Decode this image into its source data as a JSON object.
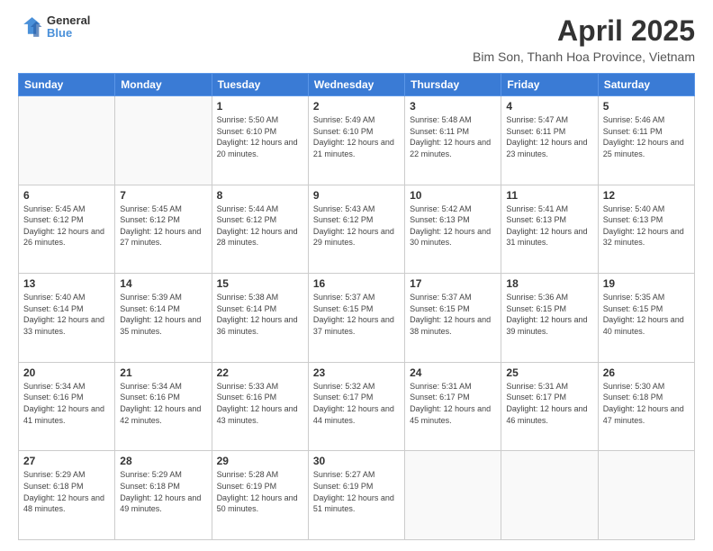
{
  "header": {
    "logo_line1": "General",
    "logo_line2": "Blue",
    "title": "April 2025",
    "location": "Bim Son, Thanh Hoa Province, Vietnam"
  },
  "calendar": {
    "days_of_week": [
      "Sunday",
      "Monday",
      "Tuesday",
      "Wednesday",
      "Thursday",
      "Friday",
      "Saturday"
    ],
    "weeks": [
      [
        {
          "day": "",
          "info": ""
        },
        {
          "day": "",
          "info": ""
        },
        {
          "day": "1",
          "info": "Sunrise: 5:50 AM\nSunset: 6:10 PM\nDaylight: 12 hours and 20 minutes."
        },
        {
          "day": "2",
          "info": "Sunrise: 5:49 AM\nSunset: 6:10 PM\nDaylight: 12 hours and 21 minutes."
        },
        {
          "day": "3",
          "info": "Sunrise: 5:48 AM\nSunset: 6:11 PM\nDaylight: 12 hours and 22 minutes."
        },
        {
          "day": "4",
          "info": "Sunrise: 5:47 AM\nSunset: 6:11 PM\nDaylight: 12 hours and 23 minutes."
        },
        {
          "day": "5",
          "info": "Sunrise: 5:46 AM\nSunset: 6:11 PM\nDaylight: 12 hours and 25 minutes."
        }
      ],
      [
        {
          "day": "6",
          "info": "Sunrise: 5:45 AM\nSunset: 6:12 PM\nDaylight: 12 hours and 26 minutes."
        },
        {
          "day": "7",
          "info": "Sunrise: 5:45 AM\nSunset: 6:12 PM\nDaylight: 12 hours and 27 minutes."
        },
        {
          "day": "8",
          "info": "Sunrise: 5:44 AM\nSunset: 6:12 PM\nDaylight: 12 hours and 28 minutes."
        },
        {
          "day": "9",
          "info": "Sunrise: 5:43 AM\nSunset: 6:12 PM\nDaylight: 12 hours and 29 minutes."
        },
        {
          "day": "10",
          "info": "Sunrise: 5:42 AM\nSunset: 6:13 PM\nDaylight: 12 hours and 30 minutes."
        },
        {
          "day": "11",
          "info": "Sunrise: 5:41 AM\nSunset: 6:13 PM\nDaylight: 12 hours and 31 minutes."
        },
        {
          "day": "12",
          "info": "Sunrise: 5:40 AM\nSunset: 6:13 PM\nDaylight: 12 hours and 32 minutes."
        }
      ],
      [
        {
          "day": "13",
          "info": "Sunrise: 5:40 AM\nSunset: 6:14 PM\nDaylight: 12 hours and 33 minutes."
        },
        {
          "day": "14",
          "info": "Sunrise: 5:39 AM\nSunset: 6:14 PM\nDaylight: 12 hours and 35 minutes."
        },
        {
          "day": "15",
          "info": "Sunrise: 5:38 AM\nSunset: 6:14 PM\nDaylight: 12 hours and 36 minutes."
        },
        {
          "day": "16",
          "info": "Sunrise: 5:37 AM\nSunset: 6:15 PM\nDaylight: 12 hours and 37 minutes."
        },
        {
          "day": "17",
          "info": "Sunrise: 5:37 AM\nSunset: 6:15 PM\nDaylight: 12 hours and 38 minutes."
        },
        {
          "day": "18",
          "info": "Sunrise: 5:36 AM\nSunset: 6:15 PM\nDaylight: 12 hours and 39 minutes."
        },
        {
          "day": "19",
          "info": "Sunrise: 5:35 AM\nSunset: 6:15 PM\nDaylight: 12 hours and 40 minutes."
        }
      ],
      [
        {
          "day": "20",
          "info": "Sunrise: 5:34 AM\nSunset: 6:16 PM\nDaylight: 12 hours and 41 minutes."
        },
        {
          "day": "21",
          "info": "Sunrise: 5:34 AM\nSunset: 6:16 PM\nDaylight: 12 hours and 42 minutes."
        },
        {
          "day": "22",
          "info": "Sunrise: 5:33 AM\nSunset: 6:16 PM\nDaylight: 12 hours and 43 minutes."
        },
        {
          "day": "23",
          "info": "Sunrise: 5:32 AM\nSunset: 6:17 PM\nDaylight: 12 hours and 44 minutes."
        },
        {
          "day": "24",
          "info": "Sunrise: 5:31 AM\nSunset: 6:17 PM\nDaylight: 12 hours and 45 minutes."
        },
        {
          "day": "25",
          "info": "Sunrise: 5:31 AM\nSunset: 6:17 PM\nDaylight: 12 hours and 46 minutes."
        },
        {
          "day": "26",
          "info": "Sunrise: 5:30 AM\nSunset: 6:18 PM\nDaylight: 12 hours and 47 minutes."
        }
      ],
      [
        {
          "day": "27",
          "info": "Sunrise: 5:29 AM\nSunset: 6:18 PM\nDaylight: 12 hours and 48 minutes."
        },
        {
          "day": "28",
          "info": "Sunrise: 5:29 AM\nSunset: 6:18 PM\nDaylight: 12 hours and 49 minutes."
        },
        {
          "day": "29",
          "info": "Sunrise: 5:28 AM\nSunset: 6:19 PM\nDaylight: 12 hours and 50 minutes."
        },
        {
          "day": "30",
          "info": "Sunrise: 5:27 AM\nSunset: 6:19 PM\nDaylight: 12 hours and 51 minutes."
        },
        {
          "day": "",
          "info": ""
        },
        {
          "day": "",
          "info": ""
        },
        {
          "day": "",
          "info": ""
        }
      ]
    ]
  }
}
